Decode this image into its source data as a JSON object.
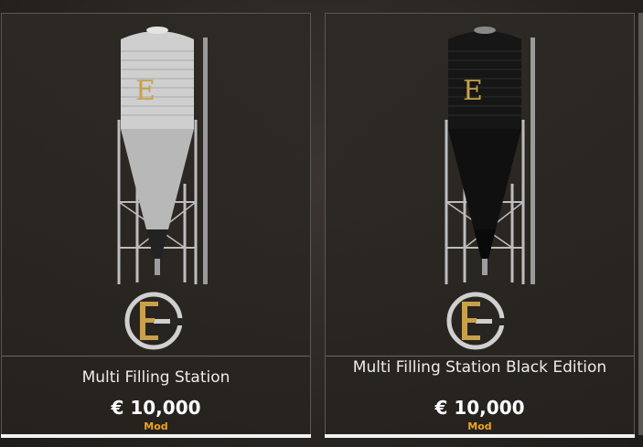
{
  "items": [
    {
      "title": "Multi Filling Station",
      "price": "€ 10,000",
      "tag": "Mod",
      "silo_color": "#c9c9c9",
      "logo_letter": "E"
    },
    {
      "title": "Multi Filling Station Black Edition",
      "price": "€ 10,000",
      "tag": "Mod",
      "silo_color": "#161616",
      "logo_letter": "E"
    }
  ],
  "colors": {
    "accent": "#f0a21c",
    "gold": "#c9a14a"
  }
}
